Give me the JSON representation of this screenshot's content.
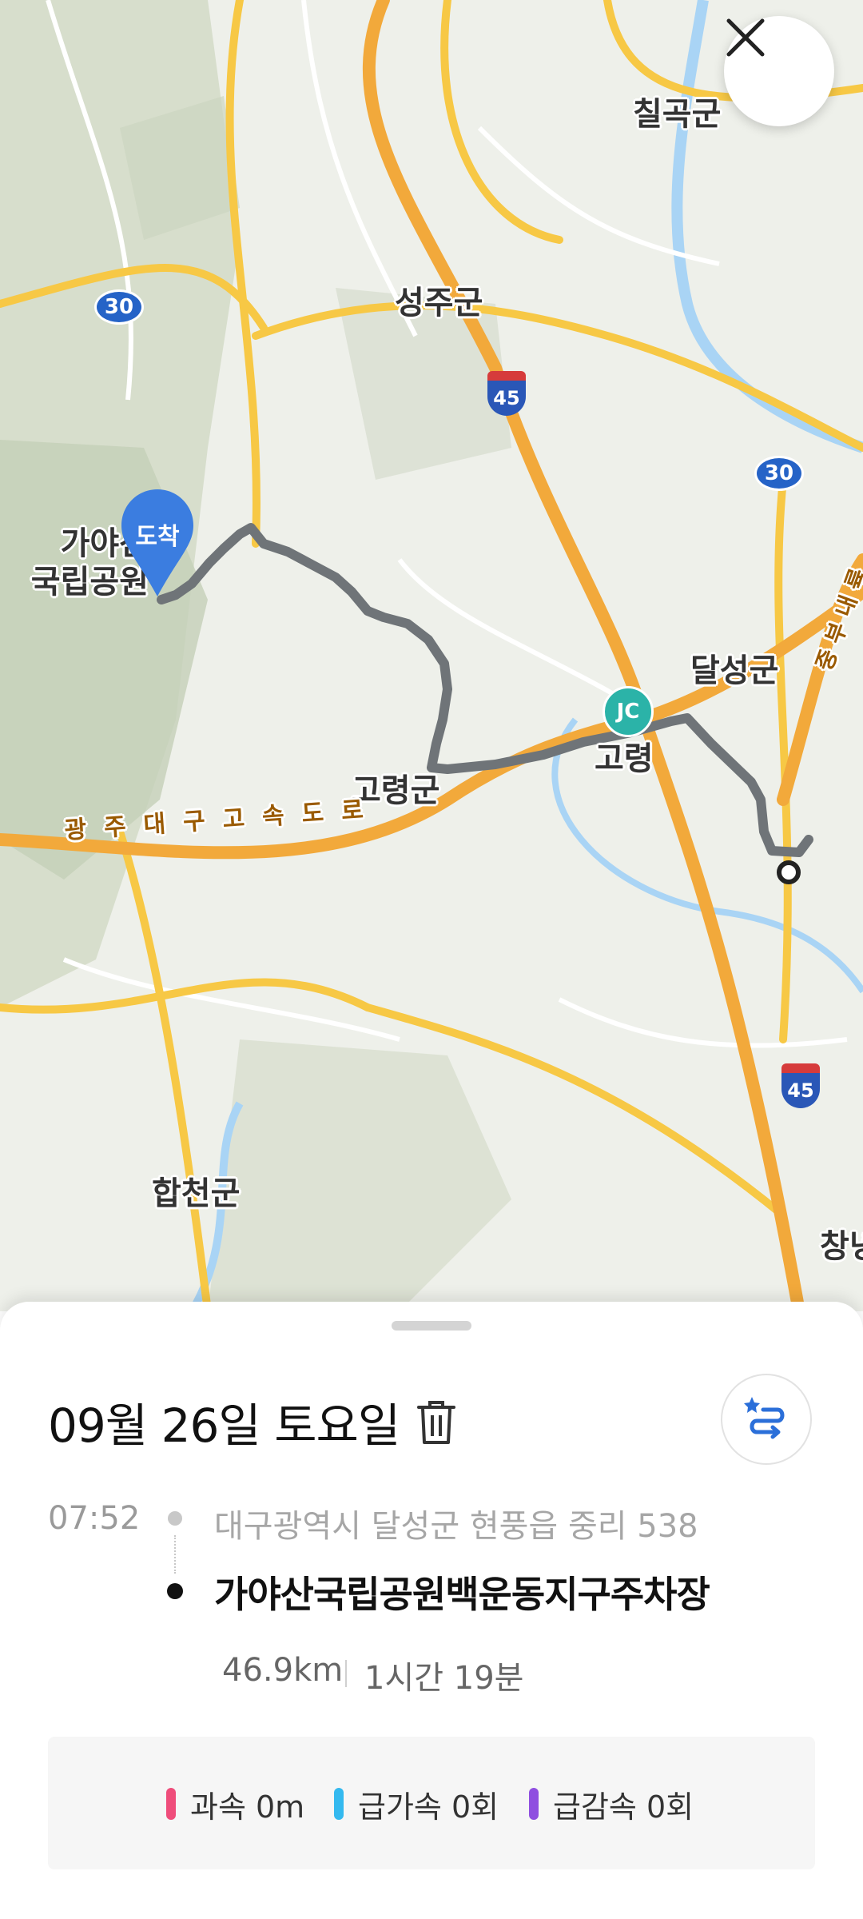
{
  "map": {
    "labels": {
      "chilgok": "칠곡군",
      "seongju": "성주군",
      "gayasan": "가야산\n국립공원",
      "dalseong": "달성군",
      "goryeong_town": "고령",
      "goryeong_gun": "고령군",
      "hapcheon": "합천군",
      "changnyeong_partial": "창녕",
      "expressway": "광주대구고속도로",
      "jungbu": "중부내륙"
    },
    "shields": {
      "route30_left": "30",
      "route30_right": "30",
      "interstate45_top": "45",
      "interstate45_bottom": "45"
    },
    "jc_label": "JC",
    "arrive_label": "도착",
    "colors": {
      "route": "#6f7478",
      "highway": "#f7c845",
      "expressway": "#f2a93b",
      "water": "#a9d4f5",
      "pin": "#3b7de0"
    }
  },
  "sheet": {
    "date_title": "09월 26일 토요일",
    "start_time": "07:52",
    "start_address": "대구광역시 달성군 현풍읍 중리 538",
    "end_place": "가야산국립공원백운동지구주차장",
    "distance": "46.9km",
    "duration": "1시간 19분",
    "stats": [
      {
        "label": "과속 0m",
        "color": "#ef4d7b"
      },
      {
        "label": "급가속 0회",
        "color": "#34b9ef"
      },
      {
        "label": "급감속 0회",
        "color": "#8f4fe0"
      }
    ]
  }
}
